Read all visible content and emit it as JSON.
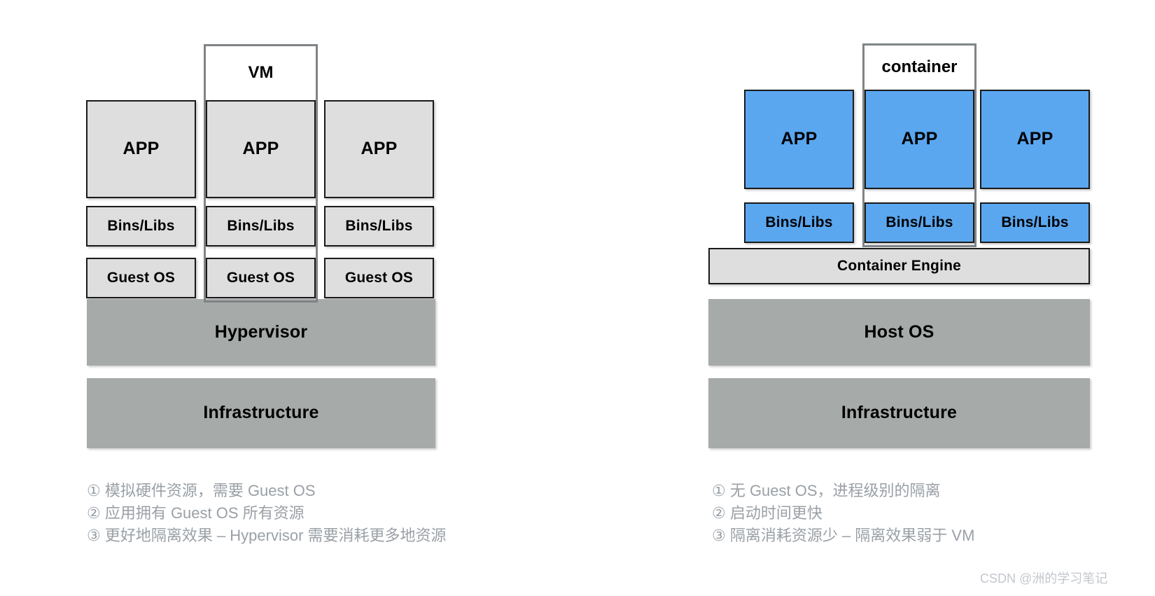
{
  "diagram": {
    "title_semantics": "virtual-machines-vs-containers",
    "colors": {
      "app_box_left": "#dedede",
      "app_box_right": "#5aa7f0",
      "platform_band": "#a6aaa9",
      "engine_band": "#dedede",
      "frame_border": "#808486",
      "box_border": "#1a1a1a",
      "caption_text": "#9aa0a6",
      "watermark_text": "#c3c7cc"
    },
    "left_panel": {
      "frame_label": "VM",
      "columns": [
        {
          "app": "APP",
          "bins": "Bins/Libs",
          "os": "Guest OS"
        },
        {
          "app": "APP",
          "bins": "Bins/Libs",
          "os": "Guest OS"
        },
        {
          "app": "APP",
          "bins": "Bins/Libs",
          "os": "Guest OS"
        }
      ],
      "bands": [
        {
          "label": "Hypervisor"
        },
        {
          "label": "Infrastructure"
        }
      ],
      "notes": [
        "① 模拟硬件资源，需要 Guest OS",
        "② 应用拥有 Guest OS 所有资源",
        "③ 更好地隔离效果 – Hypervisor 需要消耗更多地资源"
      ]
    },
    "right_panel": {
      "frame_label": "container",
      "columns": [
        {
          "app": "APP",
          "bins": "Bins/Libs"
        },
        {
          "app": "APP",
          "bins": "Bins/Libs"
        },
        {
          "app": "APP",
          "bins": "Bins/Libs"
        }
      ],
      "engine": {
        "label": "Container Engine"
      },
      "bands": [
        {
          "label": "Host OS"
        },
        {
          "label": "Infrastructure"
        }
      ],
      "notes": [
        "① 无 Guest OS，进程级别的隔离",
        "② 启动时间更快",
        "③ 隔离消耗资源少 – 隔离效果弱于 VM"
      ]
    },
    "watermark": "CSDN @洲的学习笔记"
  }
}
